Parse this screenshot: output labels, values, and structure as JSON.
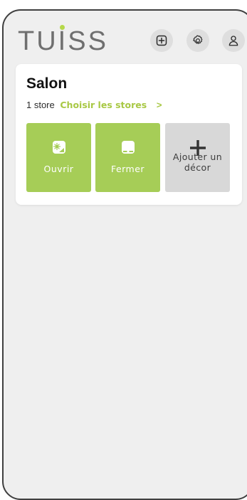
{
  "app": {
    "logo_text": "TUISS",
    "brand_color": "#a6cd57",
    "logo_dot_color": "#b5d84a"
  },
  "header": {
    "buttons": [
      {
        "icon": "add-square-icon"
      },
      {
        "icon": "gear-icon"
      },
      {
        "icon": "user-icon"
      }
    ]
  },
  "room": {
    "title": "Salon",
    "store_count": "1 store",
    "choose_link": "Choisir les stores",
    "chevron": ">"
  },
  "tiles": {
    "open": {
      "label": "Ouvrir",
      "icon": "blind-open-icon"
    },
    "close": {
      "label": "Fermer",
      "icon": "blind-close-icon"
    },
    "add": {
      "label": "Ajouter un décor",
      "icon": "plus-icon"
    }
  }
}
